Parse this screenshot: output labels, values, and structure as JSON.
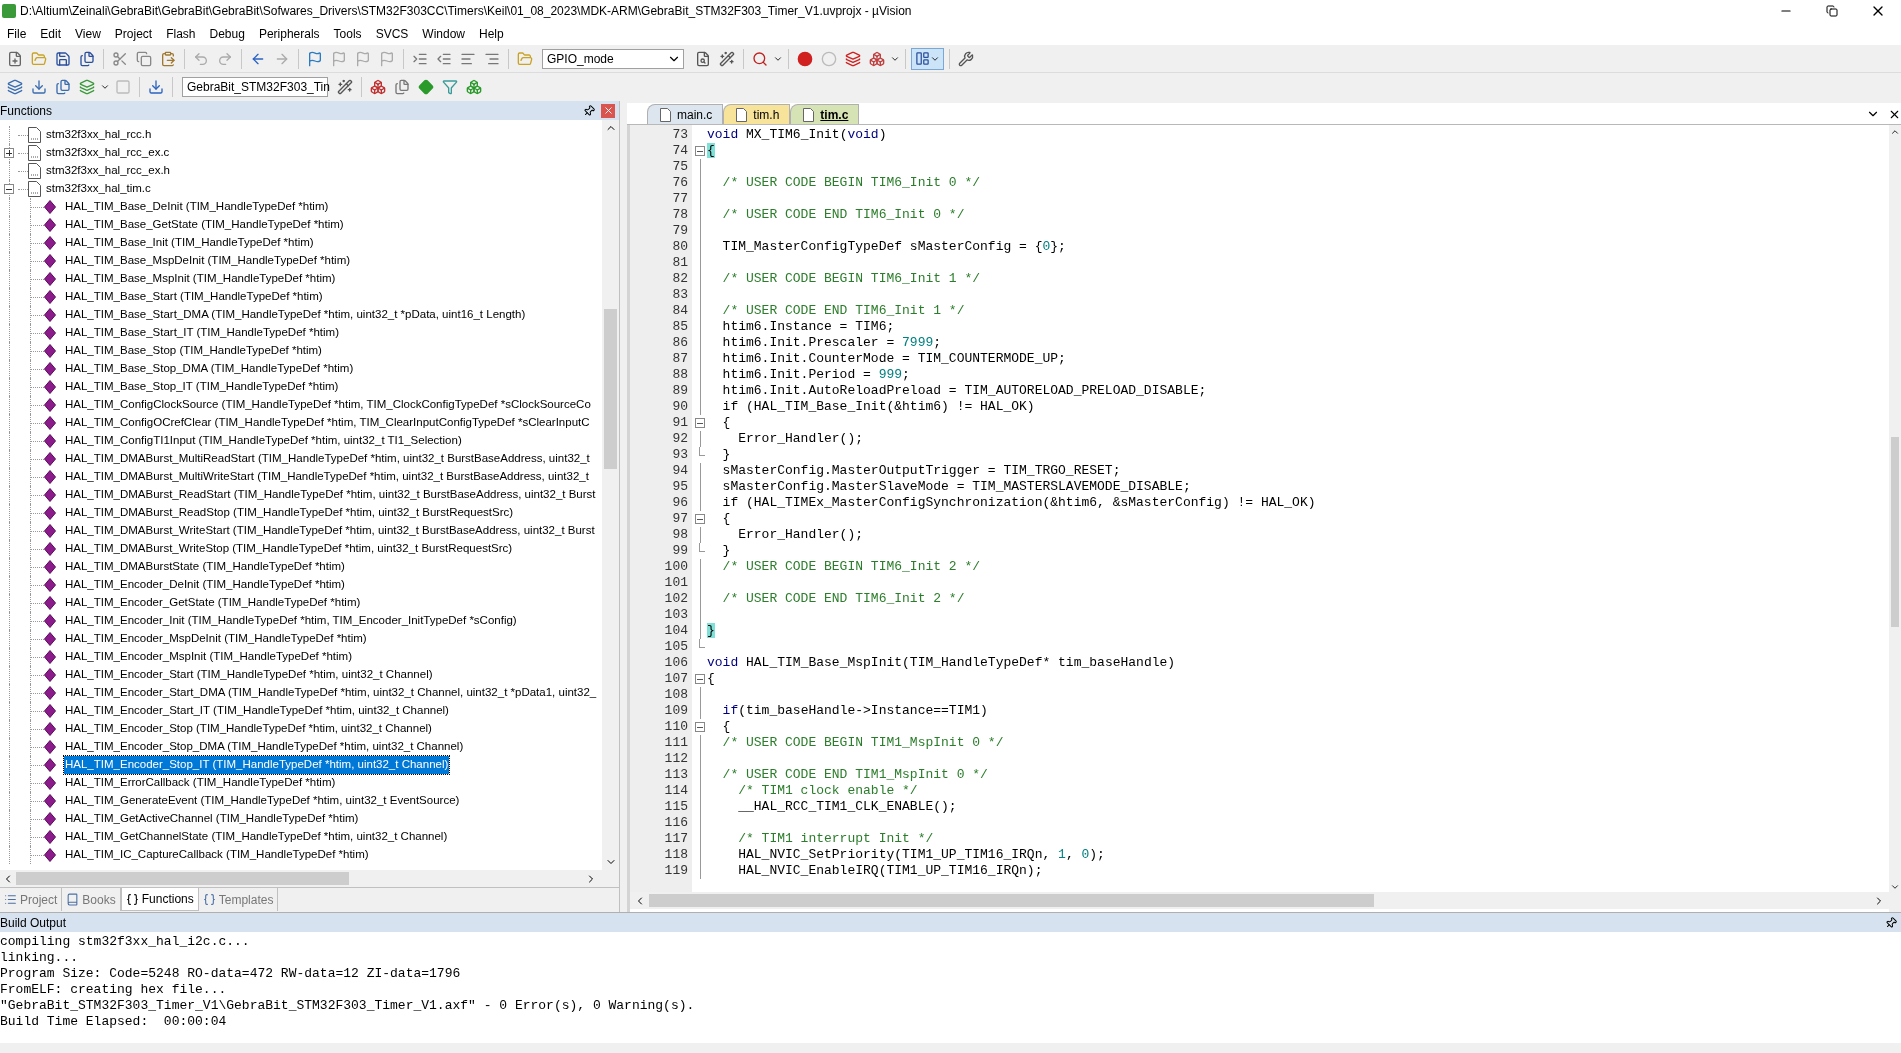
{
  "window": {
    "title": "D:\\Altium\\Zeinali\\GebraBit\\GebraBit\\GebraBit\\Sofwares_Drivers\\STM32F303CC\\Timers\\Keil\\01_08_2023\\MDK-ARM\\GebraBit_STM32F303_Timer_V1.uvprojx - µVision"
  },
  "menu": [
    "File",
    "Edit",
    "View",
    "Project",
    "Flash",
    "Debug",
    "Peripherals",
    "Tools",
    "SVCS",
    "Window",
    "Help"
  ],
  "toolbar": {
    "find_combo": "GPIO_mode",
    "target_combo": "GebraBit_STM32F303_Tin"
  },
  "functions_panel": {
    "title": "Functions",
    "items": [
      {
        "label": "stm32f3xx_hal_rcc.h"
      },
      {
        "label": "stm32f3xx_hal_rcc_ex.c",
        "expanded": false
      },
      {
        "label": "stm32f3xx_hal_rcc_ex.h"
      },
      {
        "label": "stm32f3xx_hal_tim.c",
        "expanded": true,
        "children": [
          {
            "label": "HAL_TIM_Base_DeInit (TIM_HandleTypeDef *htim)",
            "selected": false
          },
          {
            "label": "HAL_TIM_Base_GetState (TIM_HandleTypeDef *htim)",
            "selected": false
          },
          {
            "label": "HAL_TIM_Base_Init (TIM_HandleTypeDef *htim)",
            "selected": false
          },
          {
            "label": "HAL_TIM_Base_MspDeInit (TIM_HandleTypeDef *htim)",
            "selected": false
          },
          {
            "label": "HAL_TIM_Base_MspInit (TIM_HandleTypeDef *htim)",
            "selected": false
          },
          {
            "label": "HAL_TIM_Base_Start (TIM_HandleTypeDef *htim)",
            "selected": false
          },
          {
            "label": "HAL_TIM_Base_Start_DMA (TIM_HandleTypeDef *htim, uint32_t *pData, uint16_t Length)",
            "selected": false
          },
          {
            "label": "HAL_TIM_Base_Start_IT (TIM_HandleTypeDef *htim)",
            "selected": false
          },
          {
            "label": "HAL_TIM_Base_Stop (TIM_HandleTypeDef *htim)",
            "selected": false
          },
          {
            "label": "HAL_TIM_Base_Stop_DMA (TIM_HandleTypeDef *htim)",
            "selected": false
          },
          {
            "label": "HAL_TIM_Base_Stop_IT (TIM_HandleTypeDef *htim)",
            "selected": false
          },
          {
            "label": "HAL_TIM_ConfigClockSource (TIM_HandleTypeDef *htim, TIM_ClockConfigTypeDef *sClockSourceCo",
            "selected": false
          },
          {
            "label": "HAL_TIM_ConfigOCrefClear (TIM_HandleTypeDef *htim, TIM_ClearInputConfigTypeDef *sClearInputC",
            "selected": false
          },
          {
            "label": "HAL_TIM_ConfigTI1Input (TIM_HandleTypeDef *htim, uint32_t TI1_Selection)",
            "selected": false
          },
          {
            "label": "HAL_TIM_DMABurst_MultiReadStart (TIM_HandleTypeDef *htim, uint32_t BurstBaseAddress, uint32_t",
            "selected": false
          },
          {
            "label": "HAL_TIM_DMABurst_MultiWriteStart (TIM_HandleTypeDef *htim, uint32_t BurstBaseAddress, uint32_t",
            "selected": false
          },
          {
            "label": "HAL_TIM_DMABurst_ReadStart (TIM_HandleTypeDef *htim, uint32_t BurstBaseAddress, uint32_t Burst",
            "selected": false
          },
          {
            "label": "HAL_TIM_DMABurst_ReadStop (TIM_HandleTypeDef *htim, uint32_t BurstRequestSrc)",
            "selected": false
          },
          {
            "label": "HAL_TIM_DMABurst_WriteStart (TIM_HandleTypeDef *htim, uint32_t BurstBaseAddress, uint32_t Burst",
            "selected": false
          },
          {
            "label": "HAL_TIM_DMABurst_WriteStop (TIM_HandleTypeDef *htim, uint32_t BurstRequestSrc)",
            "selected": false
          },
          {
            "label": "HAL_TIM_DMABurstState (TIM_HandleTypeDef *htim)",
            "selected": false
          },
          {
            "label": "HAL_TIM_Encoder_DeInit (TIM_HandleTypeDef *htim)",
            "selected": false
          },
          {
            "label": "HAL_TIM_Encoder_GetState (TIM_HandleTypeDef *htim)",
            "selected": false
          },
          {
            "label": "HAL_TIM_Encoder_Init (TIM_HandleTypeDef *htim, TIM_Encoder_InitTypeDef *sConfig)",
            "selected": false
          },
          {
            "label": "HAL_TIM_Encoder_MspDeInit (TIM_HandleTypeDef *htim)",
            "selected": false
          },
          {
            "label": "HAL_TIM_Encoder_MspInit (TIM_HandleTypeDef *htim)",
            "selected": false
          },
          {
            "label": "HAL_TIM_Encoder_Start (TIM_HandleTypeDef *htim, uint32_t Channel)",
            "selected": false
          },
          {
            "label": "HAL_TIM_Encoder_Start_DMA (TIM_HandleTypeDef *htim, uint32_t Channel, uint32_t *pData1, uint32_",
            "selected": false
          },
          {
            "label": "HAL_TIM_Encoder_Start_IT (TIM_HandleTypeDef *htim, uint32_t Channel)",
            "selected": false
          },
          {
            "label": "HAL_TIM_Encoder_Stop (TIM_HandleTypeDef *htim, uint32_t Channel)",
            "selected": false
          },
          {
            "label": "HAL_TIM_Encoder_Stop_DMA (TIM_HandleTypeDef *htim, uint32_t Channel)",
            "selected": false
          },
          {
            "label": "HAL_TIM_Encoder_Stop_IT (TIM_HandleTypeDef *htim, uint32_t Channel)",
            "selected": true
          },
          {
            "label": "HAL_TIM_ErrorCallback (TIM_HandleTypeDef *htim)",
            "selected": false
          },
          {
            "label": "HAL_TIM_GenerateEvent (TIM_HandleTypeDef *htim, uint32_t EventSource)",
            "selected": false
          },
          {
            "label": "HAL_TIM_GetActiveChannel (TIM_HandleTypeDef *htim)",
            "selected": false
          },
          {
            "label": "HAL_TIM_GetChannelState (TIM_HandleTypeDef *htim, uint32_t Channel)",
            "selected": false
          },
          {
            "label": "HAL_TIM_IC_CaptureCallback (TIM_HandleTypeDef *htim)",
            "selected": false
          }
        ]
      }
    ],
    "tabs": [
      {
        "label": "Project",
        "selected": false
      },
      {
        "label": "Books",
        "selected": false
      },
      {
        "label": "Functions",
        "selected": true
      },
      {
        "label": "Templates",
        "selected": false
      }
    ]
  },
  "editor": {
    "tabs": [
      {
        "label": "main.c",
        "selected": false,
        "color": "#dde5ef"
      },
      {
        "label": "tim.h",
        "selected": false,
        "color": "#f7e39a"
      },
      {
        "label": "tim.c",
        "selected": true,
        "color": "#d6e3b5"
      }
    ],
    "lines": [
      {
        "n": "73",
        "segs": [
          {
            "kind": "kw",
            "t": "void"
          },
          {
            "kind": "tx",
            "t": " MX_TIM6_Init("
          },
          {
            "kind": "kw",
            "t": "void"
          },
          {
            "kind": "tx",
            "t": ")"
          }
        ]
      },
      {
        "n": "74",
        "fold_open": true,
        "segs": [
          {
            "kind": "brace",
            "t": "{"
          }
        ]
      },
      {
        "n": "75",
        "fold_line": true
      },
      {
        "n": "76",
        "fold_line": true,
        "segs": [
          {
            "kind": "cm",
            "t": "  /* USER CODE BEGIN TIM6_Init 0 */"
          }
        ]
      },
      {
        "n": "77",
        "fold_line": true
      },
      {
        "n": "78",
        "fold_line": true,
        "segs": [
          {
            "kind": "cm",
            "t": "  /* USER CODE END TIM6_Init 0 */"
          }
        ]
      },
      {
        "n": "79",
        "fold_line": true
      },
      {
        "n": "80",
        "fold_line": true,
        "segs": [
          {
            "kind": "tx",
            "t": "  TIM_MasterConfigTypeDef sMasterConfig = {"
          },
          {
            "kind": "num",
            "t": "0"
          },
          {
            "kind": "tx",
            "t": "};"
          }
        ]
      },
      {
        "n": "81",
        "fold_line": true
      },
      {
        "n": "82",
        "fold_line": true,
        "segs": [
          {
            "kind": "cm",
            "t": "  /* USER CODE BEGIN TIM6_Init 1 */"
          }
        ]
      },
      {
        "n": "83",
        "fold_line": true
      },
      {
        "n": "84",
        "fold_line": true,
        "segs": [
          {
            "kind": "cm",
            "t": "  /* USER CODE END TIM6_Init 1 */"
          }
        ]
      },
      {
        "n": "85",
        "fold_line": true,
        "segs": [
          {
            "kind": "tx",
            "t": "  htim6.Instance = TIM6;"
          }
        ]
      },
      {
        "n": "86",
        "fold_line": true,
        "segs": [
          {
            "kind": "tx",
            "t": "  htim6.Init.Prescaler = "
          },
          {
            "kind": "num",
            "t": "7999"
          },
          {
            "kind": "tx",
            "t": ";"
          }
        ]
      },
      {
        "n": "87",
        "fold_line": true,
        "segs": [
          {
            "kind": "tx",
            "t": "  htim6.Init.CounterMode = TIM_COUNTERMODE_UP;"
          }
        ]
      },
      {
        "n": "88",
        "fold_line": true,
        "segs": [
          {
            "kind": "tx",
            "t": "  htim6.Init.Period = "
          },
          {
            "kind": "num",
            "t": "999"
          },
          {
            "kind": "tx",
            "t": ";"
          }
        ]
      },
      {
        "n": "89",
        "fold_line": true,
        "segs": [
          {
            "kind": "tx",
            "t": "  htim6.Init.AutoReloadPreload = TIM_AUTORELOAD_PRELOAD_DISABLE;"
          }
        ]
      },
      {
        "n": "90",
        "fold_line": true,
        "segs": [
          {
            "kind": "tx",
            "t": "  if (HAL_TIM_Base_Init(&htim6) != HAL_OK)"
          }
        ]
      },
      {
        "n": "91",
        "fold_open": true,
        "segs": [
          {
            "kind": "tx",
            "t": "  {"
          }
        ]
      },
      {
        "n": "92",
        "fold_line": true,
        "segs": [
          {
            "kind": "tx",
            "t": "    Error_Handler();"
          }
        ]
      },
      {
        "n": "93",
        "fold_end": true,
        "segs": [
          {
            "kind": "tx",
            "t": "  }"
          }
        ]
      },
      {
        "n": "94",
        "fold_line": true,
        "segs": [
          {
            "kind": "tx",
            "t": "  sMasterConfig.MasterOutputTrigger = TIM_TRGO_RESET;"
          }
        ]
      },
      {
        "n": "95",
        "fold_line": true,
        "segs": [
          {
            "kind": "tx",
            "t": "  sMasterConfig.MasterSlaveMode = TIM_MASTERSLAVEMODE_DISABLE;"
          }
        ]
      },
      {
        "n": "96",
        "fold_line": true,
        "segs": [
          {
            "kind": "tx",
            "t": "  if (HAL_TIMEx_MasterConfigSynchronization(&htim6, &sMasterConfig) != HAL_OK)"
          }
        ]
      },
      {
        "n": "97",
        "fold_open": true,
        "segs": [
          {
            "kind": "tx",
            "t": "  {"
          }
        ]
      },
      {
        "n": "98",
        "fold_line": true,
        "segs": [
          {
            "kind": "tx",
            "t": "    Error_Handler();"
          }
        ]
      },
      {
        "n": "99",
        "fold_end": true,
        "segs": [
          {
            "kind": "tx",
            "t": "  }"
          }
        ]
      },
      {
        "n": "100",
        "fold_line": true,
        "segs": [
          {
            "kind": "cm",
            "t": "  /* USER CODE BEGIN TIM6_Init 2 */"
          }
        ]
      },
      {
        "n": "101",
        "fold_line": true
      },
      {
        "n": "102",
        "fold_line": true,
        "segs": [
          {
            "kind": "cm",
            "t": "  /* USER CODE END TIM6_Init 2 */"
          }
        ]
      },
      {
        "n": "103",
        "fold_line": true
      },
      {
        "n": "104",
        "fold_line": true,
        "segs": [
          {
            "kind": "brace",
            "t": "}"
          }
        ]
      },
      {
        "n": "105",
        "fold_end": true
      },
      {
        "n": "106",
        "segs": [
          {
            "kind": "kw",
            "t": "void"
          },
          {
            "kind": "tx",
            "t": " HAL_TIM_Base_MspInit(TIM_HandleTypeDef* tim_baseHandle)"
          }
        ]
      },
      {
        "n": "107",
        "fold_open": true,
        "segs": [
          {
            "kind": "tx",
            "t": "{"
          }
        ]
      },
      {
        "n": "108",
        "fold_line": true
      },
      {
        "n": "109",
        "fold_line": true,
        "segs": [
          {
            "kind": "kw",
            "t": "  if"
          },
          {
            "kind": "tx",
            "t": "(tim_baseHandle->Instance==TIM1)"
          }
        ]
      },
      {
        "n": "110",
        "fold_open": true,
        "segs": [
          {
            "kind": "tx",
            "t": "  {"
          }
        ]
      },
      {
        "n": "111",
        "fold_line": true,
        "segs": [
          {
            "kind": "cm",
            "t": "  /* USER CODE BEGIN TIM1_MspInit 0 */"
          }
        ]
      },
      {
        "n": "112",
        "fold_line": true
      },
      {
        "n": "113",
        "fold_line": true,
        "segs": [
          {
            "kind": "cm",
            "t": "  /* USER CODE END TIM1_MspInit 0 */"
          }
        ]
      },
      {
        "n": "114",
        "fold_line": true,
        "segs": [
          {
            "kind": "cm",
            "t": "    /* TIM1 clock enable */"
          }
        ]
      },
      {
        "n": "115",
        "fold_line": true,
        "segs": [
          {
            "kind": "tx",
            "t": "    __HAL_RCC_TIM1_CLK_ENABLE();"
          }
        ]
      },
      {
        "n": "116",
        "fold_line": true
      },
      {
        "n": "117",
        "fold_line": true,
        "segs": [
          {
            "kind": "cm",
            "t": "    /* TIM1 interrupt Init */"
          }
        ]
      },
      {
        "n": "118",
        "fold_line": true,
        "segs": [
          {
            "kind": "tx",
            "t": "    HAL_NVIC_SetPriority(TIM1_UP_TIM16_IRQn, "
          },
          {
            "kind": "num",
            "t": "1"
          },
          {
            "kind": "tx",
            "t": ", "
          },
          {
            "kind": "num",
            "t": "0"
          },
          {
            "kind": "tx",
            "t": ");"
          }
        ]
      },
      {
        "n": "119",
        "fold_line": true,
        "segs": [
          {
            "kind": "tx",
            "t": "    HAL_NVIC_EnableIRQ(TIM1_UP_TIM16_IRQn);"
          }
        ]
      }
    ]
  },
  "build_output": {
    "title": "Build Output",
    "lines": [
      "compiling stm32f3xx_hal_i2c.c...",
      "linking...",
      "Program Size: Code=5248 RO-data=472 RW-data=12 ZI-data=1796",
      "FromELF: creating hex file...",
      "\"GebraBit_STM32F303_Timer_V1\\GebraBit_STM32F303_Timer_V1.axf\" - 0 Error(s), 0 Warning(s).",
      "Build Time Elapsed:  00:00:04"
    ]
  }
}
